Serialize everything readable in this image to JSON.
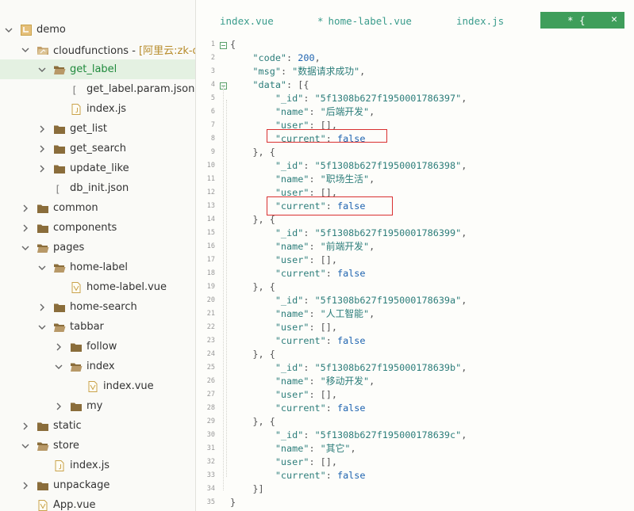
{
  "colors": {
    "accent": "#3f9e5b",
    "selected_bg": "#e4f1e2",
    "key": "#2c7d7a",
    "number": "#1f64b0",
    "highlight_box": "#d93030"
  },
  "sidebar": {
    "items": [
      {
        "label": "demo",
        "hint": "",
        "icon": "project-icon",
        "expanded": true
      },
      {
        "label": "cloudfunctions - ",
        "hint": "[阿里云:zk-dem",
        "icon": "cloud-folder-icon",
        "expanded": true
      },
      {
        "label": "get_label",
        "hint": "",
        "icon": "folder-open-icon",
        "expanded": true,
        "selected": true
      },
      {
        "label": "get_label.param.json",
        "hint": "",
        "icon": "json-file-icon"
      },
      {
        "label": "index.js",
        "hint": "",
        "icon": "js-file-icon"
      },
      {
        "label": "get_list",
        "hint": "",
        "icon": "folder-icon",
        "expanded": false
      },
      {
        "label": "get_search",
        "hint": "",
        "icon": "folder-icon",
        "expanded": false
      },
      {
        "label": "update_like",
        "hint": "",
        "icon": "folder-icon",
        "expanded": false
      },
      {
        "label": "db_init.json",
        "hint": "",
        "icon": "json-file-icon"
      },
      {
        "label": "common",
        "hint": "",
        "icon": "folder-icon",
        "expanded": false
      },
      {
        "label": "components",
        "hint": "",
        "icon": "folder-icon",
        "expanded": false
      },
      {
        "label": "pages",
        "hint": "",
        "icon": "folder-open-icon",
        "expanded": true
      },
      {
        "label": "home-label",
        "hint": "",
        "icon": "folder-open-icon",
        "expanded": true
      },
      {
        "label": "home-label.vue",
        "hint": "",
        "icon": "vue-file-icon"
      },
      {
        "label": "home-search",
        "hint": "",
        "icon": "folder-icon",
        "expanded": false
      },
      {
        "label": "tabbar",
        "hint": "",
        "icon": "folder-open-icon",
        "expanded": true
      },
      {
        "label": "follow",
        "hint": "",
        "icon": "folder-icon",
        "expanded": false
      },
      {
        "label": "index",
        "hint": "",
        "icon": "folder-open-icon",
        "expanded": true
      },
      {
        "label": "index.vue",
        "hint": "",
        "icon": "vue-file-icon"
      },
      {
        "label": "my",
        "hint": "",
        "icon": "folder-icon",
        "expanded": false
      },
      {
        "label": "static",
        "hint": "",
        "icon": "folder-icon",
        "expanded": false
      },
      {
        "label": "store",
        "hint": "",
        "icon": "folder-open-icon",
        "expanded": true
      },
      {
        "label": "index.js",
        "hint": "",
        "icon": "js-file-icon"
      },
      {
        "label": "unpackage",
        "hint": "",
        "icon": "folder-icon",
        "expanded": false
      },
      {
        "label": "App.vue",
        "hint": "",
        "icon": "vue-file-icon"
      }
    ]
  },
  "tabs": {
    "items": [
      {
        "label": "index.vue",
        "modified": false
      },
      {
        "label": "home-label.vue",
        "modified": true,
        "marker": "*"
      },
      {
        "label": "index.js",
        "modified": false
      }
    ],
    "active": {
      "label": "* {",
      "close": "✕"
    }
  },
  "code": {
    "lines": [
      "{",
      "    \"code\": 200,",
      "    \"msg\": \"数据请求成功\",",
      "    \"data\": [{",
      "        \"_id\": \"5f1308b627f1950001786397\",",
      "        \"name\": \"后端开发\",",
      "        \"user\": [],",
      "        \"current\": false",
      "    }, {",
      "        \"_id\": \"5f1308b627f1950001786398\",",
      "        \"name\": \"职场生活\",",
      "        \"user\": [],",
      "        \"current\": false",
      "    }, {",
      "        \"_id\": \"5f1308b627f1950001786399\",",
      "        \"name\": \"前端开发\",",
      "        \"user\": [],",
      "        \"current\": false",
      "    }, {",
      "        \"_id\": \"5f1308b627f195000178639a\",",
      "        \"name\": \"人工智能\",",
      "        \"user\": [],",
      "        \"current\": false",
      "    }, {",
      "        \"_id\": \"5f1308b627f195000178639b\",",
      "        \"name\": \"移动开发\",",
      "        \"user\": [],",
      "        \"current\": false",
      "    }, {",
      "        \"_id\": \"5f1308b627f195000178639c\",",
      "        \"name\": \"其它\",",
      "        \"user\": [],",
      "        \"current\": false",
      "    }]",
      "}"
    ],
    "fold_lines": [
      1,
      4
    ],
    "highlighted_lines": [
      8,
      13
    ]
  }
}
